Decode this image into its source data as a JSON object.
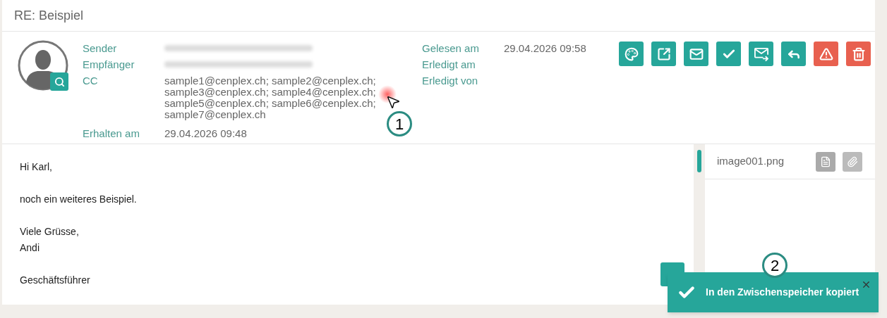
{
  "title": "RE: Beispiel",
  "header_left": [
    {
      "label": "Sender",
      "kind": "redacted"
    },
    {
      "label": "Empfänger",
      "kind": "redacted"
    },
    {
      "label": "CC",
      "kind": "text",
      "lines": [
        "sample1@cenplex.ch; sample2@cenplex.ch;",
        "sample3@cenplex.ch; sample4@cenplex.ch;",
        "sample5@cenplex.ch; sample6@cenplex.ch;",
        "sample7@cenplex.ch"
      ]
    },
    {
      "label": "Erhalten am",
      "kind": "text",
      "value": "29.04.2026 09:48"
    }
  ],
  "header_right": [
    {
      "label": "Gelesen am",
      "value": "29.04.2026 09:58"
    },
    {
      "label": "Erledigt am"
    },
    {
      "label": "Erledigt von"
    }
  ],
  "actions": [
    {
      "kind": "palette",
      "color": "#26a69a"
    },
    {
      "kind": "open",
      "color": "#26a69a"
    },
    {
      "kind": "mail",
      "color": "#26a69a"
    },
    {
      "kind": "check",
      "color": "#26a69a"
    },
    {
      "kind": "forward",
      "color": "#26a69a"
    },
    {
      "kind": "reply",
      "color": "#26a69a"
    },
    {
      "kind": "alert",
      "color": "#e8604f"
    },
    {
      "kind": "trash",
      "color": "#e8604f"
    }
  ],
  "body": [
    [
      "Hi Karl,"
    ],
    [
      "noch ein weiteres Beispiel."
    ],
    [
      "Viele Grüsse,",
      "Andi"
    ],
    [
      "Geschäftsführer"
    ]
  ],
  "attachments": [
    {
      "name": "image001.png"
    }
  ],
  "callouts": [
    "1",
    "2"
  ],
  "toast": {
    "message": "In den Zwischenspeicher kopiert"
  }
}
